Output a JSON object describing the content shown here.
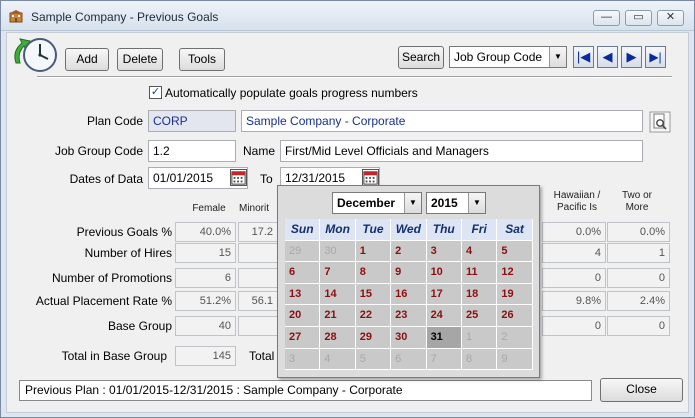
{
  "window": {
    "title": "Sample Company - Previous Goals",
    "min_glyph": "—",
    "max_glyph": "▭",
    "close_glyph": "✕"
  },
  "toolbar": {
    "add_label": "Add",
    "delete_label": "Delete",
    "tools_label": "Tools",
    "search_label": "Search",
    "search_field_value": "Job Group Code"
  },
  "auto_populate": {
    "label": "Automatically populate goals progress numbers",
    "checked": true
  },
  "plan_code": {
    "label": "Plan Code",
    "code": "CORP",
    "name": "Sample Company - Corporate"
  },
  "job_group": {
    "label": "Job Group Code",
    "code": "1.2",
    "name_label": "Name",
    "name": "First/Mid Level Officials and Managers"
  },
  "dates": {
    "label": "Dates of Data",
    "from": "01/01/2015",
    "to_label": "To",
    "to": "12/31/2015"
  },
  "columns": {
    "female": "Female",
    "minority": "Minorit",
    "hawaiian": [
      "Hawaiian /",
      "Pacific Is"
    ],
    "two_or_more": [
      "Two or",
      "More"
    ]
  },
  "rows": [
    {
      "label": "Previous Goals %",
      "female": "40.0%",
      "minority": "17.2",
      "hawaiian": "0.0%",
      "two": "0.0%"
    },
    {
      "label": "Number of Hires",
      "female": "15",
      "minority": "",
      "hawaiian": "4",
      "two": "1"
    },
    {
      "label": "Number of Promotions",
      "female": "6",
      "minority": "",
      "hawaiian": "0",
      "two": "0"
    },
    {
      "label": "Actual Placement Rate %",
      "female": "51.2%",
      "minority": "56.1",
      "hawaiian": "9.8%",
      "two": "2.4%"
    },
    {
      "label": "Base Group",
      "female": "40",
      "minority": "",
      "hawaiian": "0",
      "two": "0"
    }
  ],
  "total_base_group": {
    "label": "Total in Base Group",
    "value": "145",
    "label2": "Total"
  },
  "status": {
    "text": "Previous Plan : 01/01/2015-12/31/2015 : Sample Company - Corporate"
  },
  "close_label": "Close",
  "calendar": {
    "month": "December",
    "year": "2015",
    "days_header": [
      "Sun",
      "Mon",
      "Tue",
      "Wed",
      "Thu",
      "Fri",
      "Sat"
    ],
    "weeks": [
      [
        "29",
        "30",
        "1",
        "2",
        "3",
        "4",
        "5"
      ],
      [
        "6",
        "7",
        "8",
        "9",
        "10",
        "11",
        "12"
      ],
      [
        "13",
        "14",
        "15",
        "16",
        "17",
        "18",
        "19"
      ],
      [
        "20",
        "21",
        "22",
        "23",
        "24",
        "25",
        "26"
      ],
      [
        "27",
        "28",
        "29",
        "30",
        "31",
        "1",
        "2"
      ],
      [
        "3",
        "4",
        "5",
        "6",
        "7",
        "8",
        "9"
      ]
    ]
  },
  "colors": {
    "accent_blue": "#1a2f8f",
    "calendar_day_red": "#8b1010"
  },
  "icons": {
    "app": "building-icon",
    "clock": "clock-refresh-icon",
    "lookup": "search-document-icon",
    "calendar": "calendar-icon"
  }
}
